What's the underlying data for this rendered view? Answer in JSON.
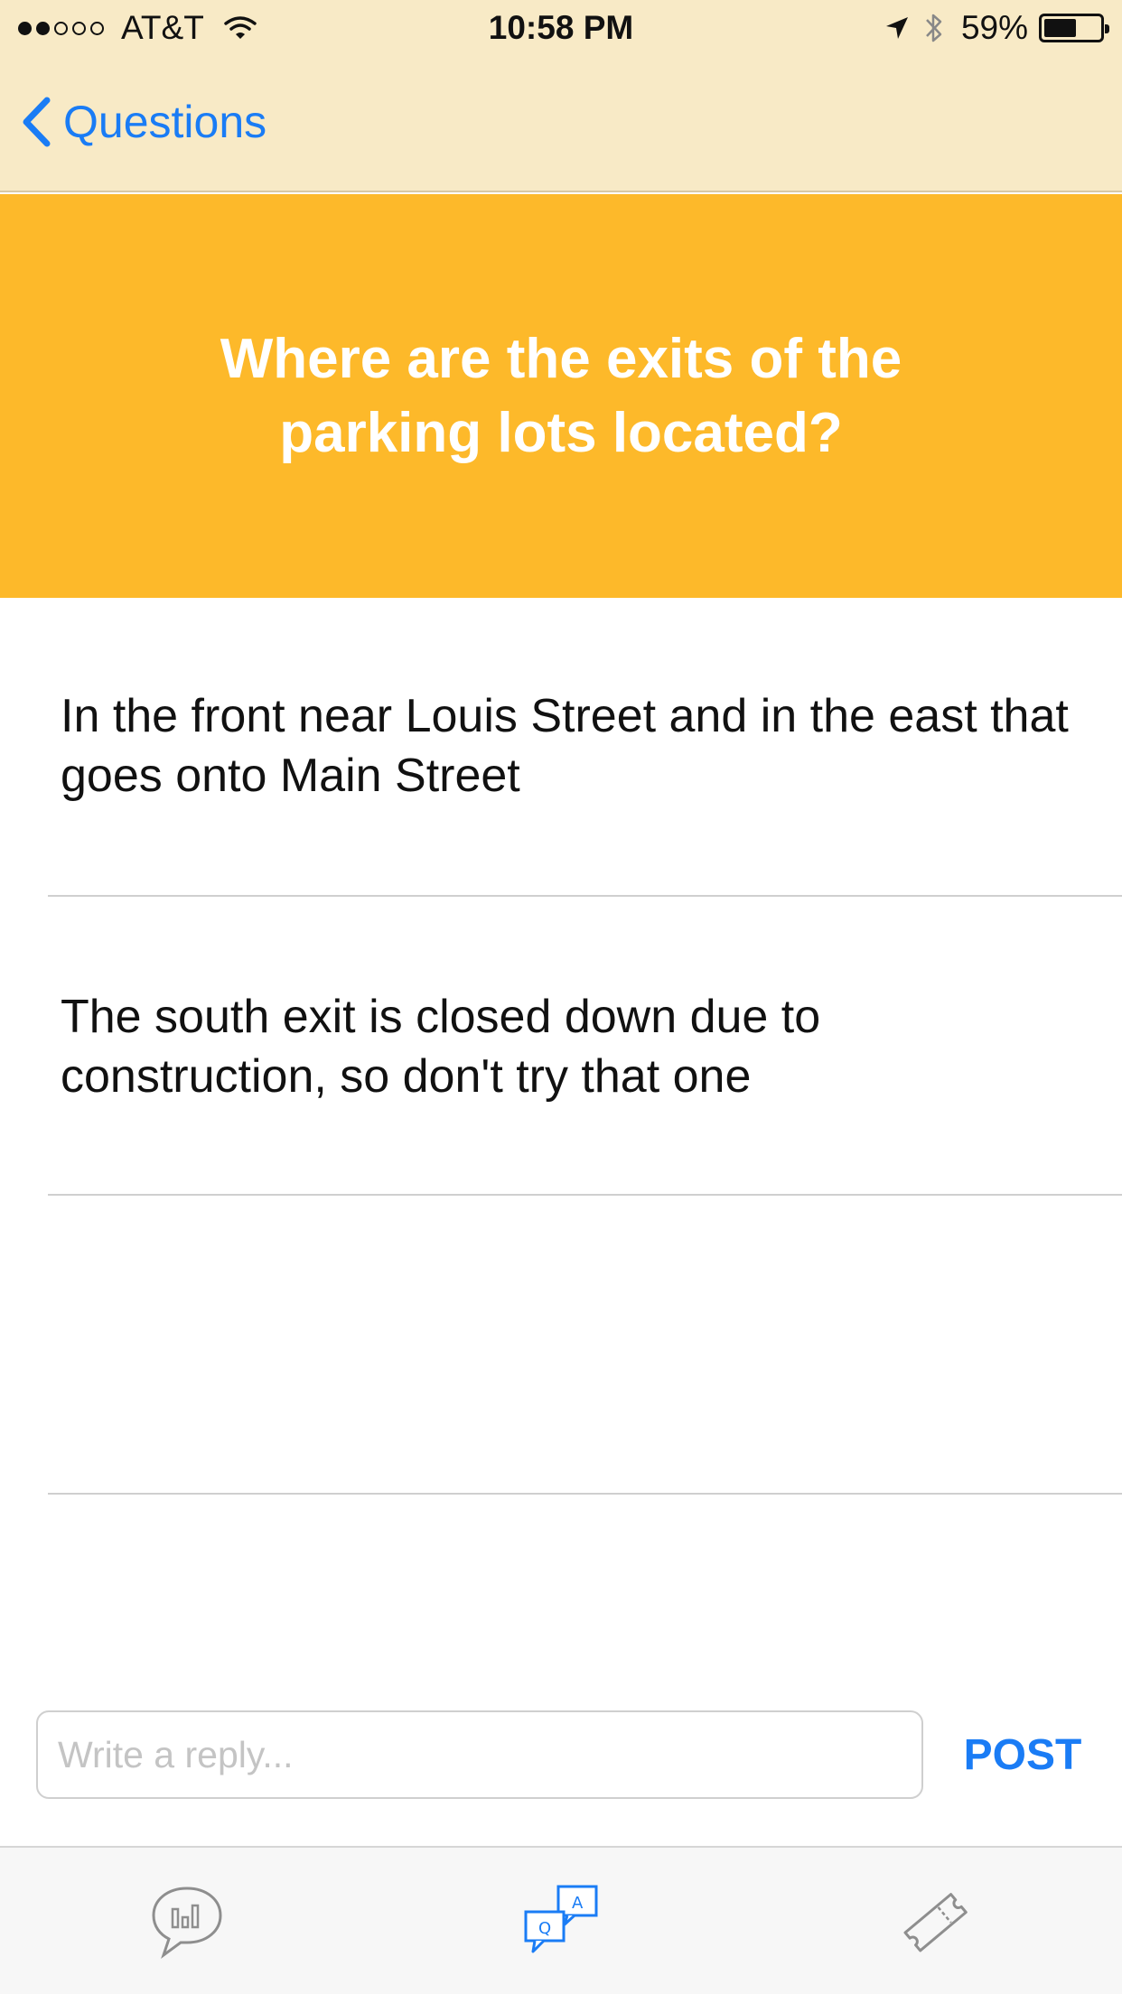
{
  "status_bar": {
    "carrier": "AT&T",
    "time": "10:58 PM",
    "battery_percent": "59%",
    "battery_level": 0.59,
    "signal_bars_filled": 2,
    "signal_bars_total": 5
  },
  "nav": {
    "back_label": "Questions"
  },
  "question": {
    "text": "Where are the exits of the parking lots located?"
  },
  "replies": [
    {
      "text": "In the front near Louis Street and in the east that goes onto Main Street"
    },
    {
      "text": "The south exit is closed down due to construction, so don't try that one"
    },
    {
      "text": ""
    }
  ],
  "composer": {
    "placeholder": "Write a reply...",
    "value": "",
    "post_label": "POST"
  },
  "tabs": [
    {
      "icon": "chat-stats-icon",
      "active": false
    },
    {
      "icon": "qa-bubbles-icon",
      "active": true
    },
    {
      "icon": "ticket-icon",
      "active": false
    }
  ],
  "colors": {
    "banner": "#fdb92a",
    "header": "#f8eac6",
    "accent": "#1a7cf5"
  }
}
